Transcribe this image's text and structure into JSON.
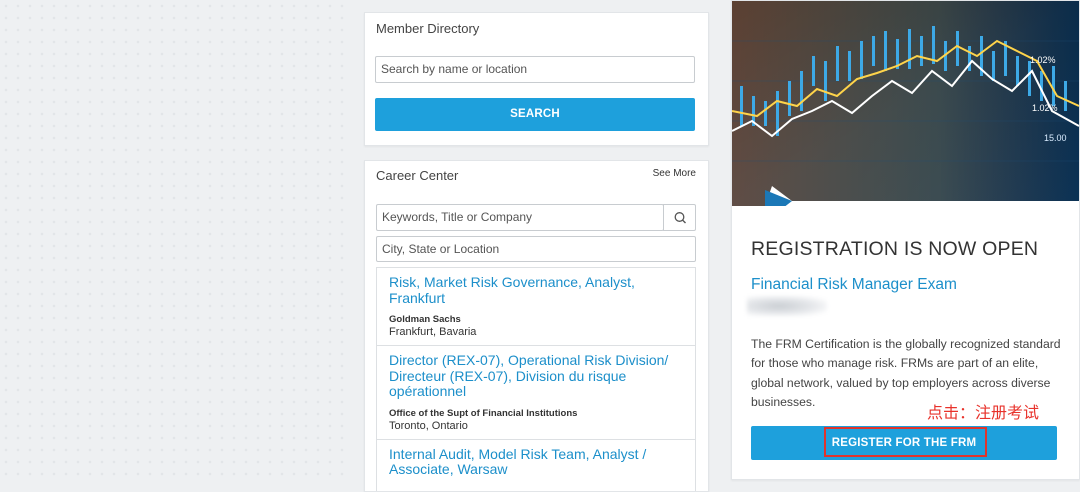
{
  "member_directory": {
    "title": "Member Directory",
    "search_placeholder": "Search by name or location",
    "search_button": "SEARCH"
  },
  "career_center": {
    "title": "Career Center",
    "see_more": "See More",
    "keywords_placeholder": "Keywords, Title or Company",
    "location_placeholder": "City, State or Location",
    "jobs": [
      {
        "title": "Risk, Market Risk Governance, Analyst, Frankfurt",
        "company": "Goldman Sachs",
        "location": "Frankfurt, Bavaria"
      },
      {
        "title": "Director (REX-07), Operational Risk Division/ Directeur (REX-07), Division du risque opérationnel",
        "company": "Office of the Supt of Financial Institutions",
        "location": "Toronto, Ontario"
      },
      {
        "title": "Internal Audit, Model Risk Team, Analyst / Associate, Warsaw",
        "company": "",
        "location": ""
      }
    ]
  },
  "promo": {
    "heading": "REGISTRATION IS NOW OPEN",
    "exam_name": "Financial Risk Manager Exam",
    "description": "The FRM Certification is the globally recognized standard for those who manage risk. FRMs are part of an elite, global network, valued by top employers across diverse businesses.",
    "annotation": "点击：注册考试",
    "register_button": "REGISTER FOR THE FRM",
    "banner_numbers": [
      "1.02%",
      "1.02%",
      "15.00"
    ],
    "accent_color": "#1ea0dc",
    "annotation_color": "#e8322b"
  }
}
